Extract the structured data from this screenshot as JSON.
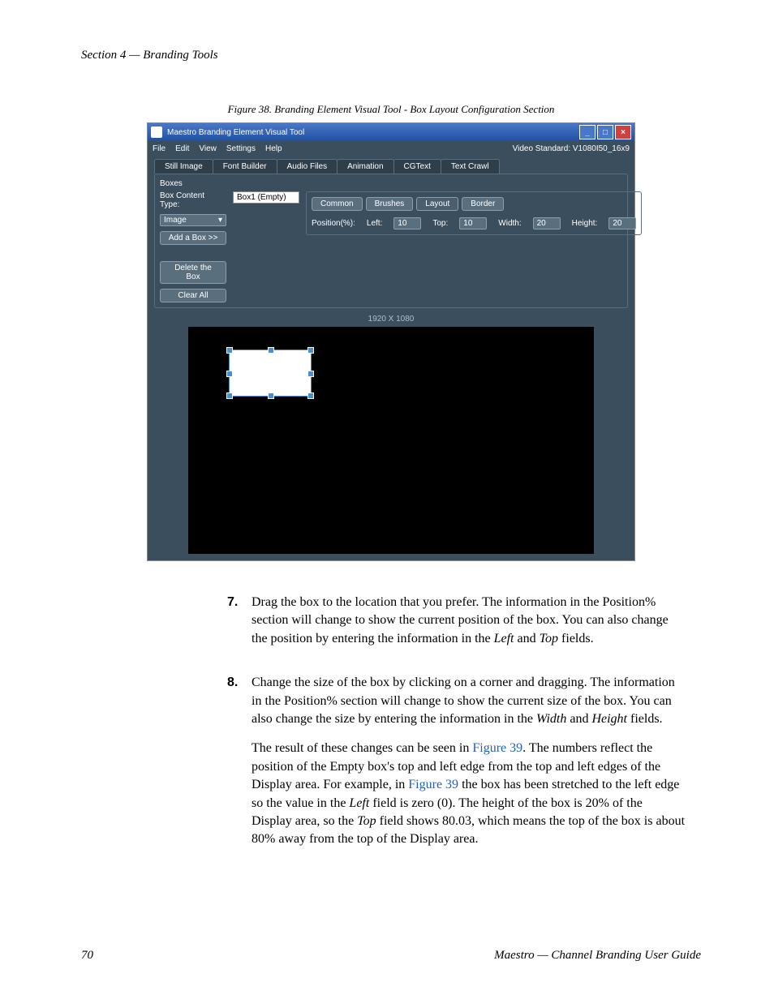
{
  "header": "Section 4 — Branding Tools",
  "figure_caption": "Figure 38.  Branding Element Visual Tool - Box Layout Configuration Section",
  "app": {
    "title": "Maestro Branding Element Visual Tool",
    "menu": {
      "file": "File",
      "edit": "Edit",
      "view": "View",
      "settings": "Settings",
      "help": "Help"
    },
    "video_std": "Video Standard: V1080I50_16x9",
    "tabs": {
      "still": "Still Image",
      "font": "Font Builder",
      "audio": "Audio Files",
      "anim": "Animation",
      "cgtext": "CGText",
      "crawl": "Text Crawl"
    },
    "boxes": {
      "title": "Boxes",
      "content_type_label": "Box Content Type:",
      "content_type_value": "Box1 (Empty)",
      "image_label": "Image",
      "add": "Add a Box >>",
      "delete": "Delete the Box",
      "clear": "Clear All"
    },
    "subtabs": {
      "common": "Common",
      "brushes": "Brushes",
      "layout": "Layout",
      "border": "Border"
    },
    "pos": {
      "label": "Position(%):",
      "left_l": "Left:",
      "left_v": "10",
      "top_l": "Top:",
      "top_v": "10",
      "width_l": "Width:",
      "width_v": "20",
      "height_l": "Height:",
      "height_v": "20"
    },
    "preview_label": "1920 X 1080"
  },
  "steps": {
    "s7_num": "7.",
    "s7": "Drag the box to the location that you prefer. The information in the Position% section will change to show the current position of the box. You can also change the position by entering the information in the ",
    "s7_left": "Left",
    "s7_and": " and ",
    "s7_top": "Top",
    "s7_end": " fields.",
    "s8_num": "8.",
    "s8a": "Change the size of the box by clicking on a corner and dragging. The information in the Position% section will change to show the current size of the box. You can also change the size by entering the information in the ",
    "s8_width": "Width",
    "s8_and": " and ",
    "s8_height": "Height",
    "s8_end": " fields.",
    "s8b_1": "The result of these changes can be seen in ",
    "s8b_fig1": "Figure 39",
    "s8b_2": ". The numbers reflect the position of the Empty box's top and left edge from the top and left edges of the Display area. For example, in ",
    "s8b_fig2": "Figure 39",
    "s8b_3": " the box has been stretched to the left edge so the value in the ",
    "s8b_left": "Left",
    "s8b_4": " field is zero (0). The height of the box is 20% of the Display area, so the ",
    "s8b_top": "Top",
    "s8b_5": " field shows 80.03, which means the top of the box is about 80% away from the top of the Display area."
  },
  "footer": {
    "page": "70",
    "title": "Maestro  —  Channel Branding User Guide"
  }
}
